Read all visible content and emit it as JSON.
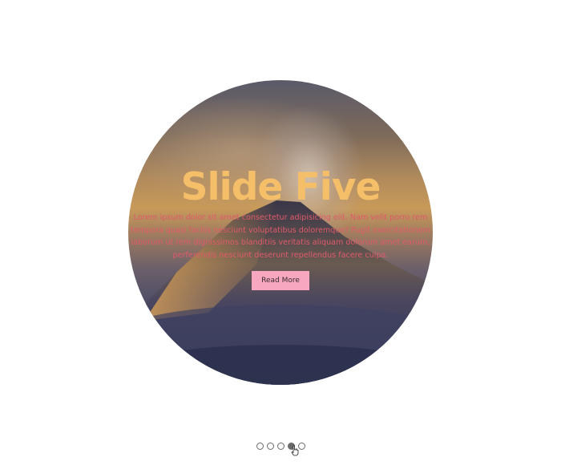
{
  "slider": {
    "title": "Slide Five",
    "text": "Lorem ipsum dolor sit amet consectetur adipisicing elit. Nam velit porro rem tempora quasi facilis nesciunt voluptatibus doloremque? Fugit exercitationem laborum ut rem dignissimos blanditiis veritatis aliquam dolorum amet earum, perferendis nesciunt deserunt repellendus facere culpa.",
    "button_label": "Read More",
    "colors": {
      "title": "#f5bf6a",
      "text": "#e05a6a",
      "button_bg": "#f7a8c0"
    }
  },
  "pagination": {
    "dots": [
      "slide-1",
      "slide-2",
      "slide-3",
      "slide-4",
      "slide-5"
    ],
    "active": 4
  }
}
